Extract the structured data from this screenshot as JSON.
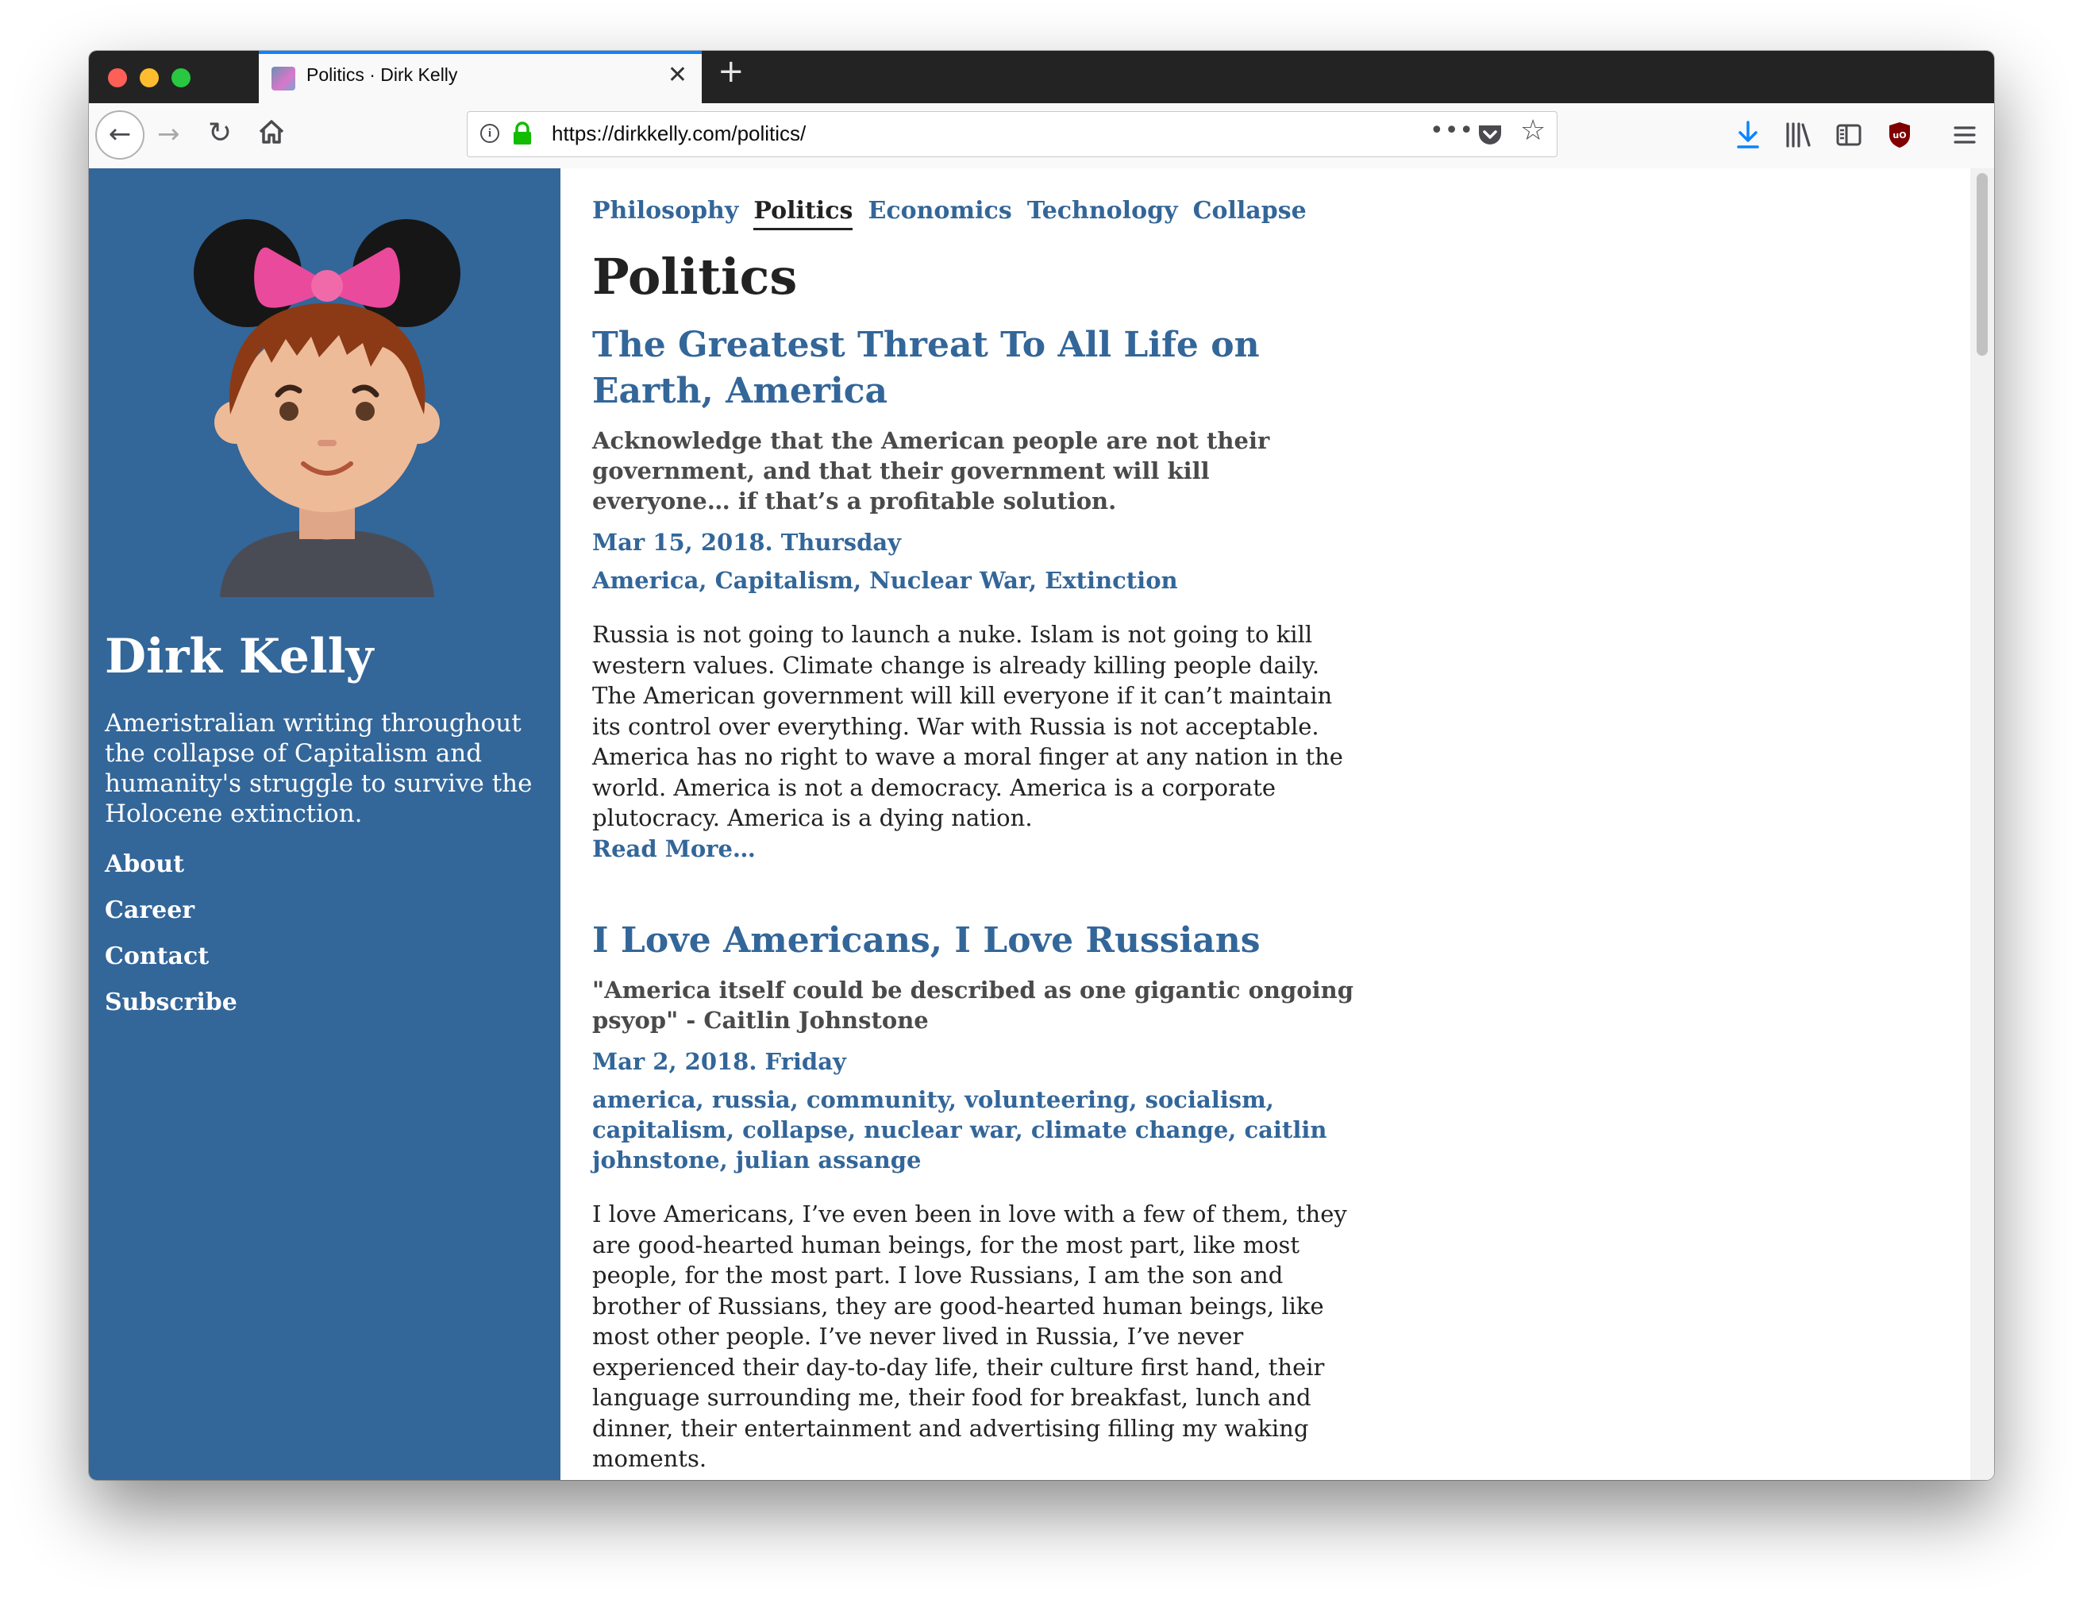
{
  "browser": {
    "tab_title": "Politics · Dirk Kelly",
    "url": "https://dirkkelly.com/politics/",
    "new_tab_symbol": "+",
    "close_symbol": "✕",
    "more_symbol": "•••",
    "icons": [
      "back-arrow-icon",
      "forward-arrow-icon",
      "reload-icon",
      "home-icon",
      "info-icon",
      "lock-icon",
      "page-actions-icon",
      "pocket-icon",
      "bookmark-star-icon",
      "download-icon",
      "library-icon",
      "sidebar-icon",
      "ublock-icon",
      "menu-icon"
    ],
    "colors": {
      "accent": "#0a84ff",
      "lock": "#12bc00",
      "download": "#0a84ff",
      "ublock": "#800000"
    }
  },
  "sidebar": {
    "name": "Dirk Kelly",
    "description": "Ameristralian writing throughout the collapse of Capitalism and humanity's struggle to survive the Holocene extinction.",
    "links": [
      {
        "label": "About"
      },
      {
        "label": "Career"
      },
      {
        "label": "Contact"
      },
      {
        "label": "Subscribe"
      }
    ],
    "background_color": "#336699"
  },
  "topnav": [
    {
      "label": "Philosophy"
    },
    {
      "label": "Politics",
      "active": true
    },
    {
      "label": "Economics"
    },
    {
      "label": "Technology"
    },
    {
      "label": "Collapse"
    }
  ],
  "page_heading": "Politics",
  "posts": [
    {
      "title": "The Greatest Threat To All Life on Earth, America",
      "subtitle": "Acknowledge that the American people are not their government, and that their government will kill everyone… if that’s a profitable solution.",
      "date": "Mar 15, 2018. Thursday",
      "tags": "America, Capitalism, Nuclear War, Extinction",
      "excerpt": "Russia is not going to launch a nuke. Islam is not going to kill western values. Climate change is already killing people daily. The American government will kill everyone if it can’t maintain its control over everything. War with Russia is not acceptable. America has no right to wave a moral finger at any nation in the world. America is not a democracy. America is a corporate plutocracy. America is a dying nation.",
      "read_more": "Read More…"
    },
    {
      "title": "I Love Americans, I Love Russians",
      "subtitle": "\"America itself could be described as one gigantic ongoing psyop\" - Caitlin Johnstone",
      "date": "Mar 2, 2018. Friday",
      "tags": "america, russia, community, volunteering, socialism, capitalism, collapse, nuclear war, climate change, caitlin johnstone, julian assange",
      "excerpt": "I love Americans, I’ve even been in love with a few of them, they are good-hearted human beings, for the most part, like most people, for the most part. I love Russians, I am the son and brother of Russians, they are good-hearted human beings, like most other people. I’ve never lived in Russia, I’ve never experienced their day-to-day life, their culture first hand, their language surrounding me, their food for breakfast, lunch and dinner, their entertainment and advertising filling my waking moments."
    }
  ]
}
